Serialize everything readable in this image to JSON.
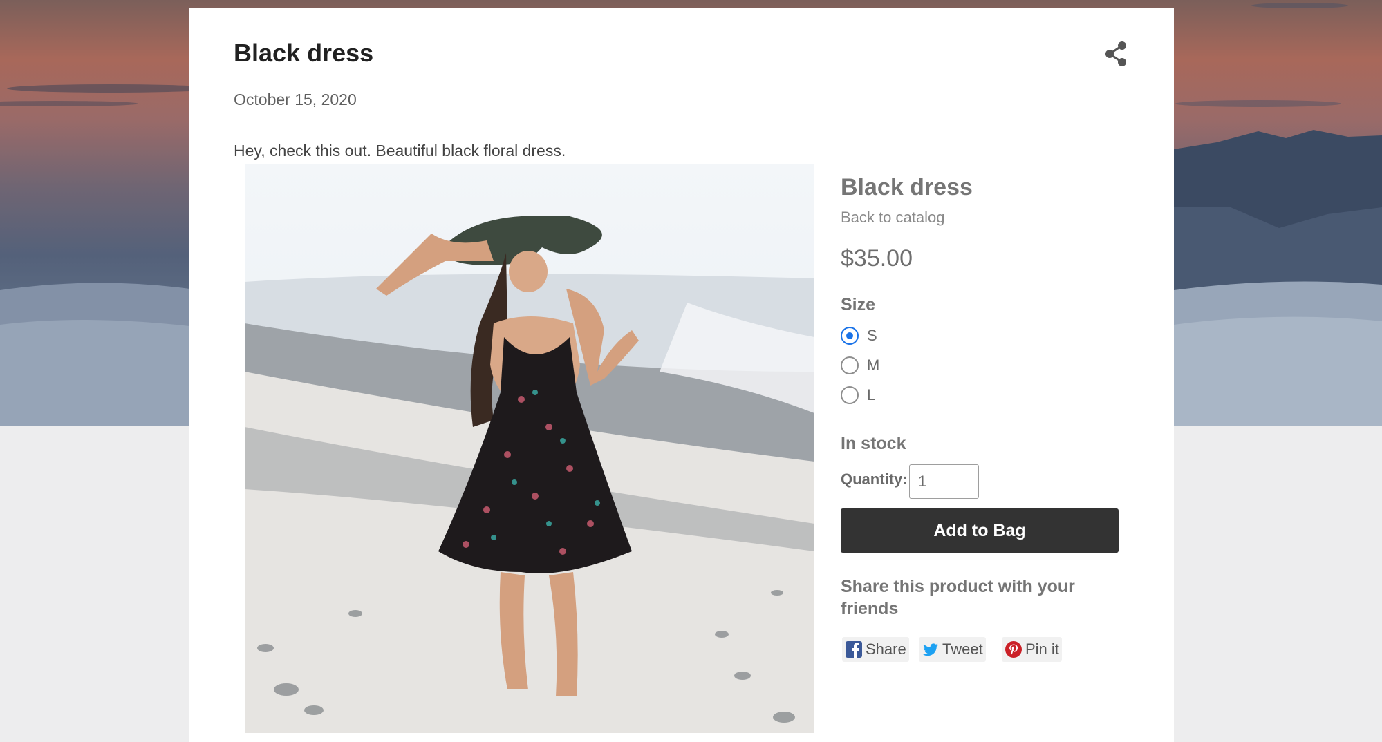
{
  "post": {
    "title": "Black dress",
    "date": "October 15, 2020",
    "body": "Hey, check this out. Beautiful black floral dress."
  },
  "product": {
    "title": "Black dress",
    "back_link": "Back to catalog",
    "price": "$35.00",
    "size_label": "Size",
    "sizes": [
      {
        "label": "S",
        "selected": true
      },
      {
        "label": "M",
        "selected": false
      },
      {
        "label": "L",
        "selected": false
      }
    ],
    "stock_status": "In stock",
    "quantity_label": "Quantity:",
    "quantity_value": "1",
    "add_button": "Add to Bag",
    "share_heading": "Share this product with your friends",
    "social": [
      {
        "label": "Share",
        "icon": "facebook-icon",
        "color": "#3b5998"
      },
      {
        "label": "Tweet",
        "icon": "twitter-icon",
        "color": "#1da1f2"
      },
      {
        "label": "Pin it",
        "icon": "pinterest-icon",
        "color": "#cb2027"
      }
    ]
  },
  "colors": {
    "accent": "#1a73e8",
    "button_bg": "#333333",
    "page_bg": "#ededee"
  }
}
